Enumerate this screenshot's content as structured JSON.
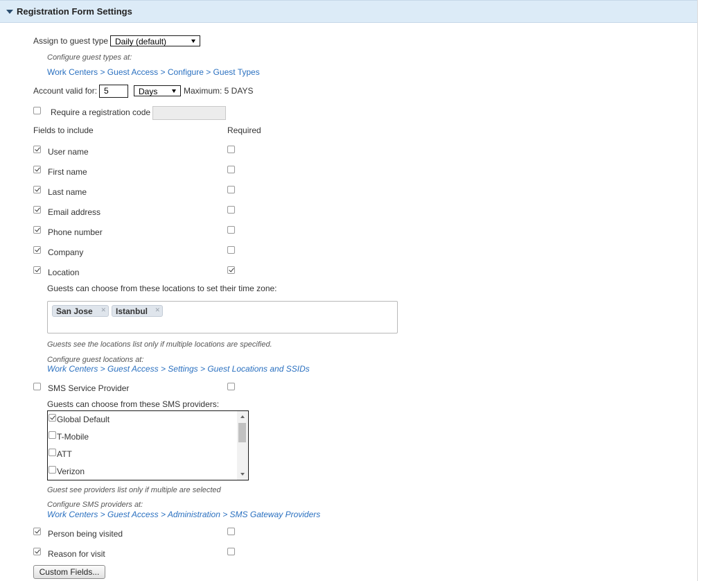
{
  "section": {
    "title": "Registration Form Settings"
  },
  "guest_type": {
    "label": "Assign to guest type",
    "value": "Daily (default)",
    "hint": "Configure guest types at:",
    "link": "Work Centers > Guest Access > Configure > Guest Types"
  },
  "account_valid": {
    "label": "Account valid for:",
    "value": "5",
    "unit": "Days",
    "maximum": "Maximum: 5 DAYS"
  },
  "registration_code": {
    "label": "Require a registration code",
    "checked": false,
    "value": ""
  },
  "fields_header": {
    "include": "Fields to include",
    "required": "Required"
  },
  "fields": [
    {
      "label": "User name",
      "include": true,
      "required": false
    },
    {
      "label": "First name",
      "include": true,
      "required": false
    },
    {
      "label": "Last name",
      "include": true,
      "required": false
    },
    {
      "label": "Email address",
      "include": true,
      "required": false
    },
    {
      "label": "Phone number",
      "include": true,
      "required": false
    },
    {
      "label": "Company",
      "include": true,
      "required": false
    },
    {
      "label": "Location",
      "include": true,
      "required": true
    }
  ],
  "locations": {
    "prompt": "Guests can choose from these locations to set their time zone:",
    "tags": [
      "San Jose",
      "Istanbul"
    ],
    "hint": "Guests see the locations list only if multiple locations are specified.",
    "configure_hint": "Configure guest locations at:",
    "configure_link": "Work Centers > Guest Access > Settings > Guest Locations and SSIDs"
  },
  "sms": {
    "label": "SMS Service Provider",
    "include": false,
    "required": false,
    "prompt": "Guests can choose from these SMS providers:",
    "providers": [
      {
        "label": "Global Default",
        "checked": true
      },
      {
        "label": "T-Mobile",
        "checked": false
      },
      {
        "label": "ATT",
        "checked": false
      },
      {
        "label": "Verizon",
        "checked": false
      }
    ],
    "hint": "Guest see providers list only if multiple are selected",
    "configure_hint": "Configure SMS providers at:",
    "configure_link": "Work Centers > Guest Access > Administration > SMS Gateway Providers"
  },
  "extra_fields": [
    {
      "label": "Person being visited",
      "include": true,
      "required": false
    },
    {
      "label": "Reason for visit",
      "include": true,
      "required": false
    }
  ],
  "custom_fields_button": "Custom Fields..."
}
